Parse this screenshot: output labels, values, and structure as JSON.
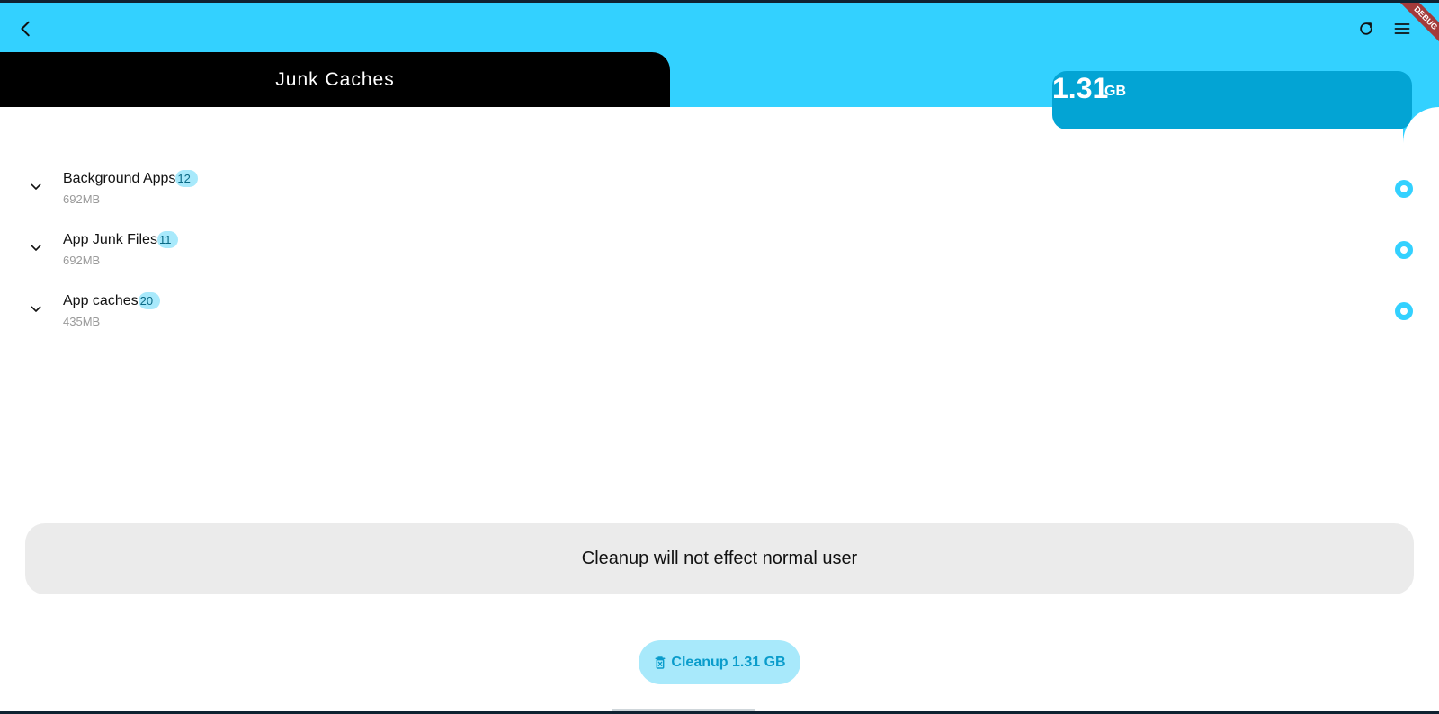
{
  "appbar": {
    "back_icon": "arrow-back-icon",
    "refresh_icon": "refresh-icon",
    "menu_icon": "hamburger-menu-icon",
    "debug_banner": "DEBUG",
    "accent_color": "#33d1ff"
  },
  "tab": {
    "title": "Junk Caches"
  },
  "summary": {
    "size_value": "1.31",
    "size_unit": "GB",
    "card_color": "#03a4d4"
  },
  "categories": [
    {
      "title": "Background Apps",
      "count": "12",
      "size": "692MB",
      "selected": true
    },
    {
      "title": "App Junk Files",
      "count": "11",
      "size": "692MB",
      "selected": true
    },
    {
      "title": "App caches",
      "count": "20",
      "size": "435MB",
      "selected": true
    }
  ],
  "notice": {
    "text": "Cleanup will not effect normal user"
  },
  "action": {
    "cleanup_label": "Cleanup 1.31 GB",
    "icon": "delete-bin-icon"
  }
}
